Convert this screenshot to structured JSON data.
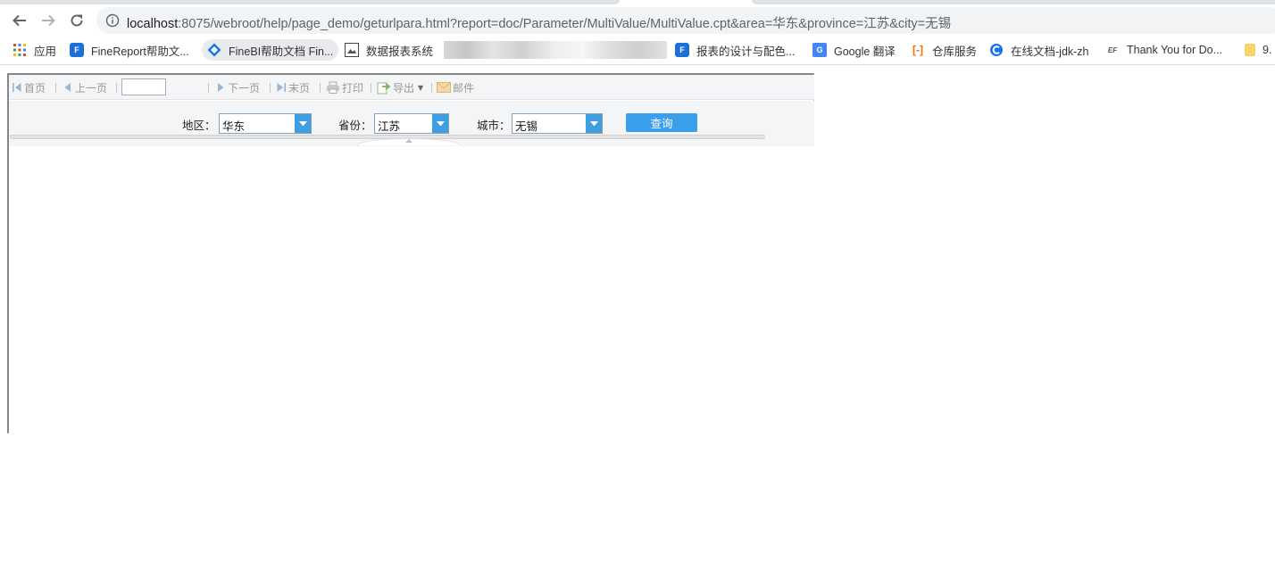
{
  "browser": {
    "url_host": "localhost",
    "url_rest": ":8075/webroot/help/page_demo/geturlpara.html?report=doc/Parameter/MultiValue/MultiValue.cpt&area=华东&province=江苏&city=无锡"
  },
  "bookmarks": [
    {
      "label": "应用",
      "icon": "apps-grid-icon"
    },
    {
      "label": "FineReport帮助文...",
      "icon": "finereport-icon"
    },
    {
      "label": "FineBI帮助文档 Fin...",
      "icon": "finebi-icon"
    },
    {
      "label": "数据报表系统",
      "icon": "image-icon"
    },
    {
      "label": "报表的设计与配色...",
      "icon": "finereport-icon"
    },
    {
      "label": "Google 翻译",
      "icon": "google-translate-icon"
    },
    {
      "label": "仓库服务",
      "icon": "aliyun-icon"
    },
    {
      "label": "在线文档-jdk-zh",
      "icon": "c-circle-icon"
    },
    {
      "label": "Thank You for Do...",
      "icon": "ef-icon"
    },
    {
      "label": "9.",
      "icon": "folder-icon"
    }
  ],
  "toolbar": {
    "first": "首页",
    "prev": "上一页",
    "next": "下一页",
    "last": "末页",
    "print": "打印",
    "export": "导出",
    "mail": "邮件"
  },
  "params": {
    "area_label": "地区：",
    "area_value": "华东",
    "province_label": "省份：",
    "province_value": "江苏",
    "city_label": "城市：",
    "city_value": "无锡",
    "query_label": "查询"
  },
  "colors": {
    "accent": "#3aa0ec",
    "combo_arrow": "#3d9ee2"
  }
}
